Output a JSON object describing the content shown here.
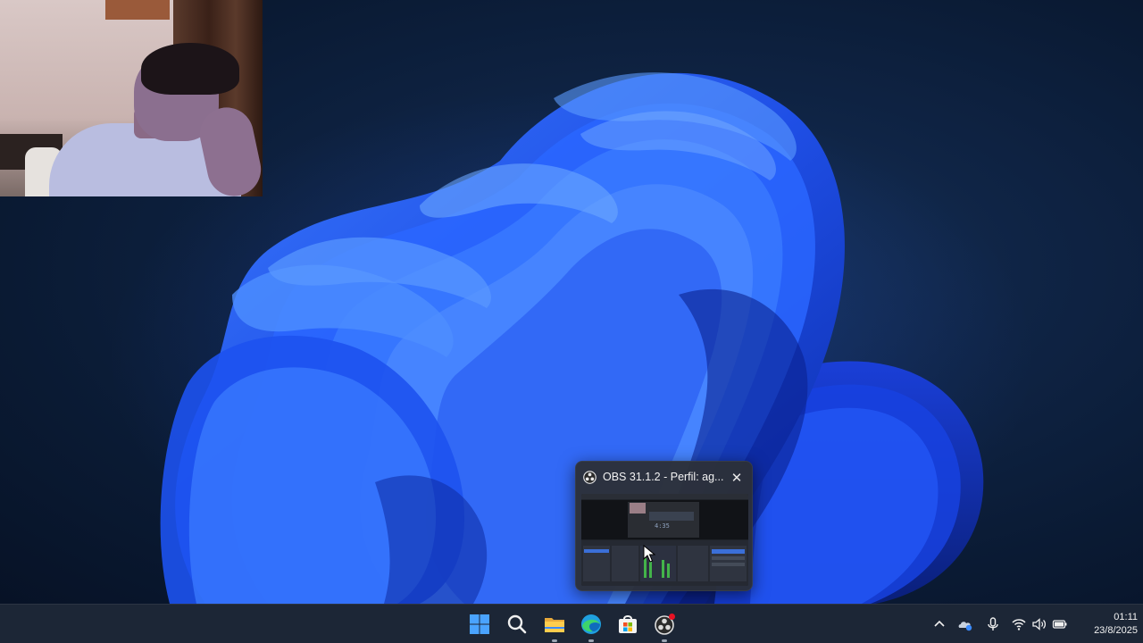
{
  "thumbnail": {
    "title": "OBS 31.1.2 - Perfil: ag...",
    "close_glyph": "✕",
    "app_icon": "obs-icon",
    "preview_counter": "4:35"
  },
  "taskbar": {
    "apps": [
      {
        "name": "start-button",
        "icon": "windows-logo-icon"
      },
      {
        "name": "search-button",
        "icon": "search-icon"
      },
      {
        "name": "file-explorer-button",
        "icon": "folder-icon"
      },
      {
        "name": "edge-button",
        "icon": "edge-icon"
      },
      {
        "name": "store-button",
        "icon": "store-icon"
      },
      {
        "name": "obs-button",
        "icon": "obs-icon"
      }
    ],
    "tray": {
      "icons": [
        "chevron-up-icon",
        "onedrive-icon",
        "microphone-icon",
        "wifi-icon",
        "volume-icon",
        "battery-icon"
      ]
    },
    "clock": {
      "time": "01:11",
      "date": "23/8/2025"
    }
  },
  "colors": {
    "accent_blue": "#1f5bff",
    "taskbar_bg": "#1c2636",
    "recording_red": "#e81123"
  }
}
